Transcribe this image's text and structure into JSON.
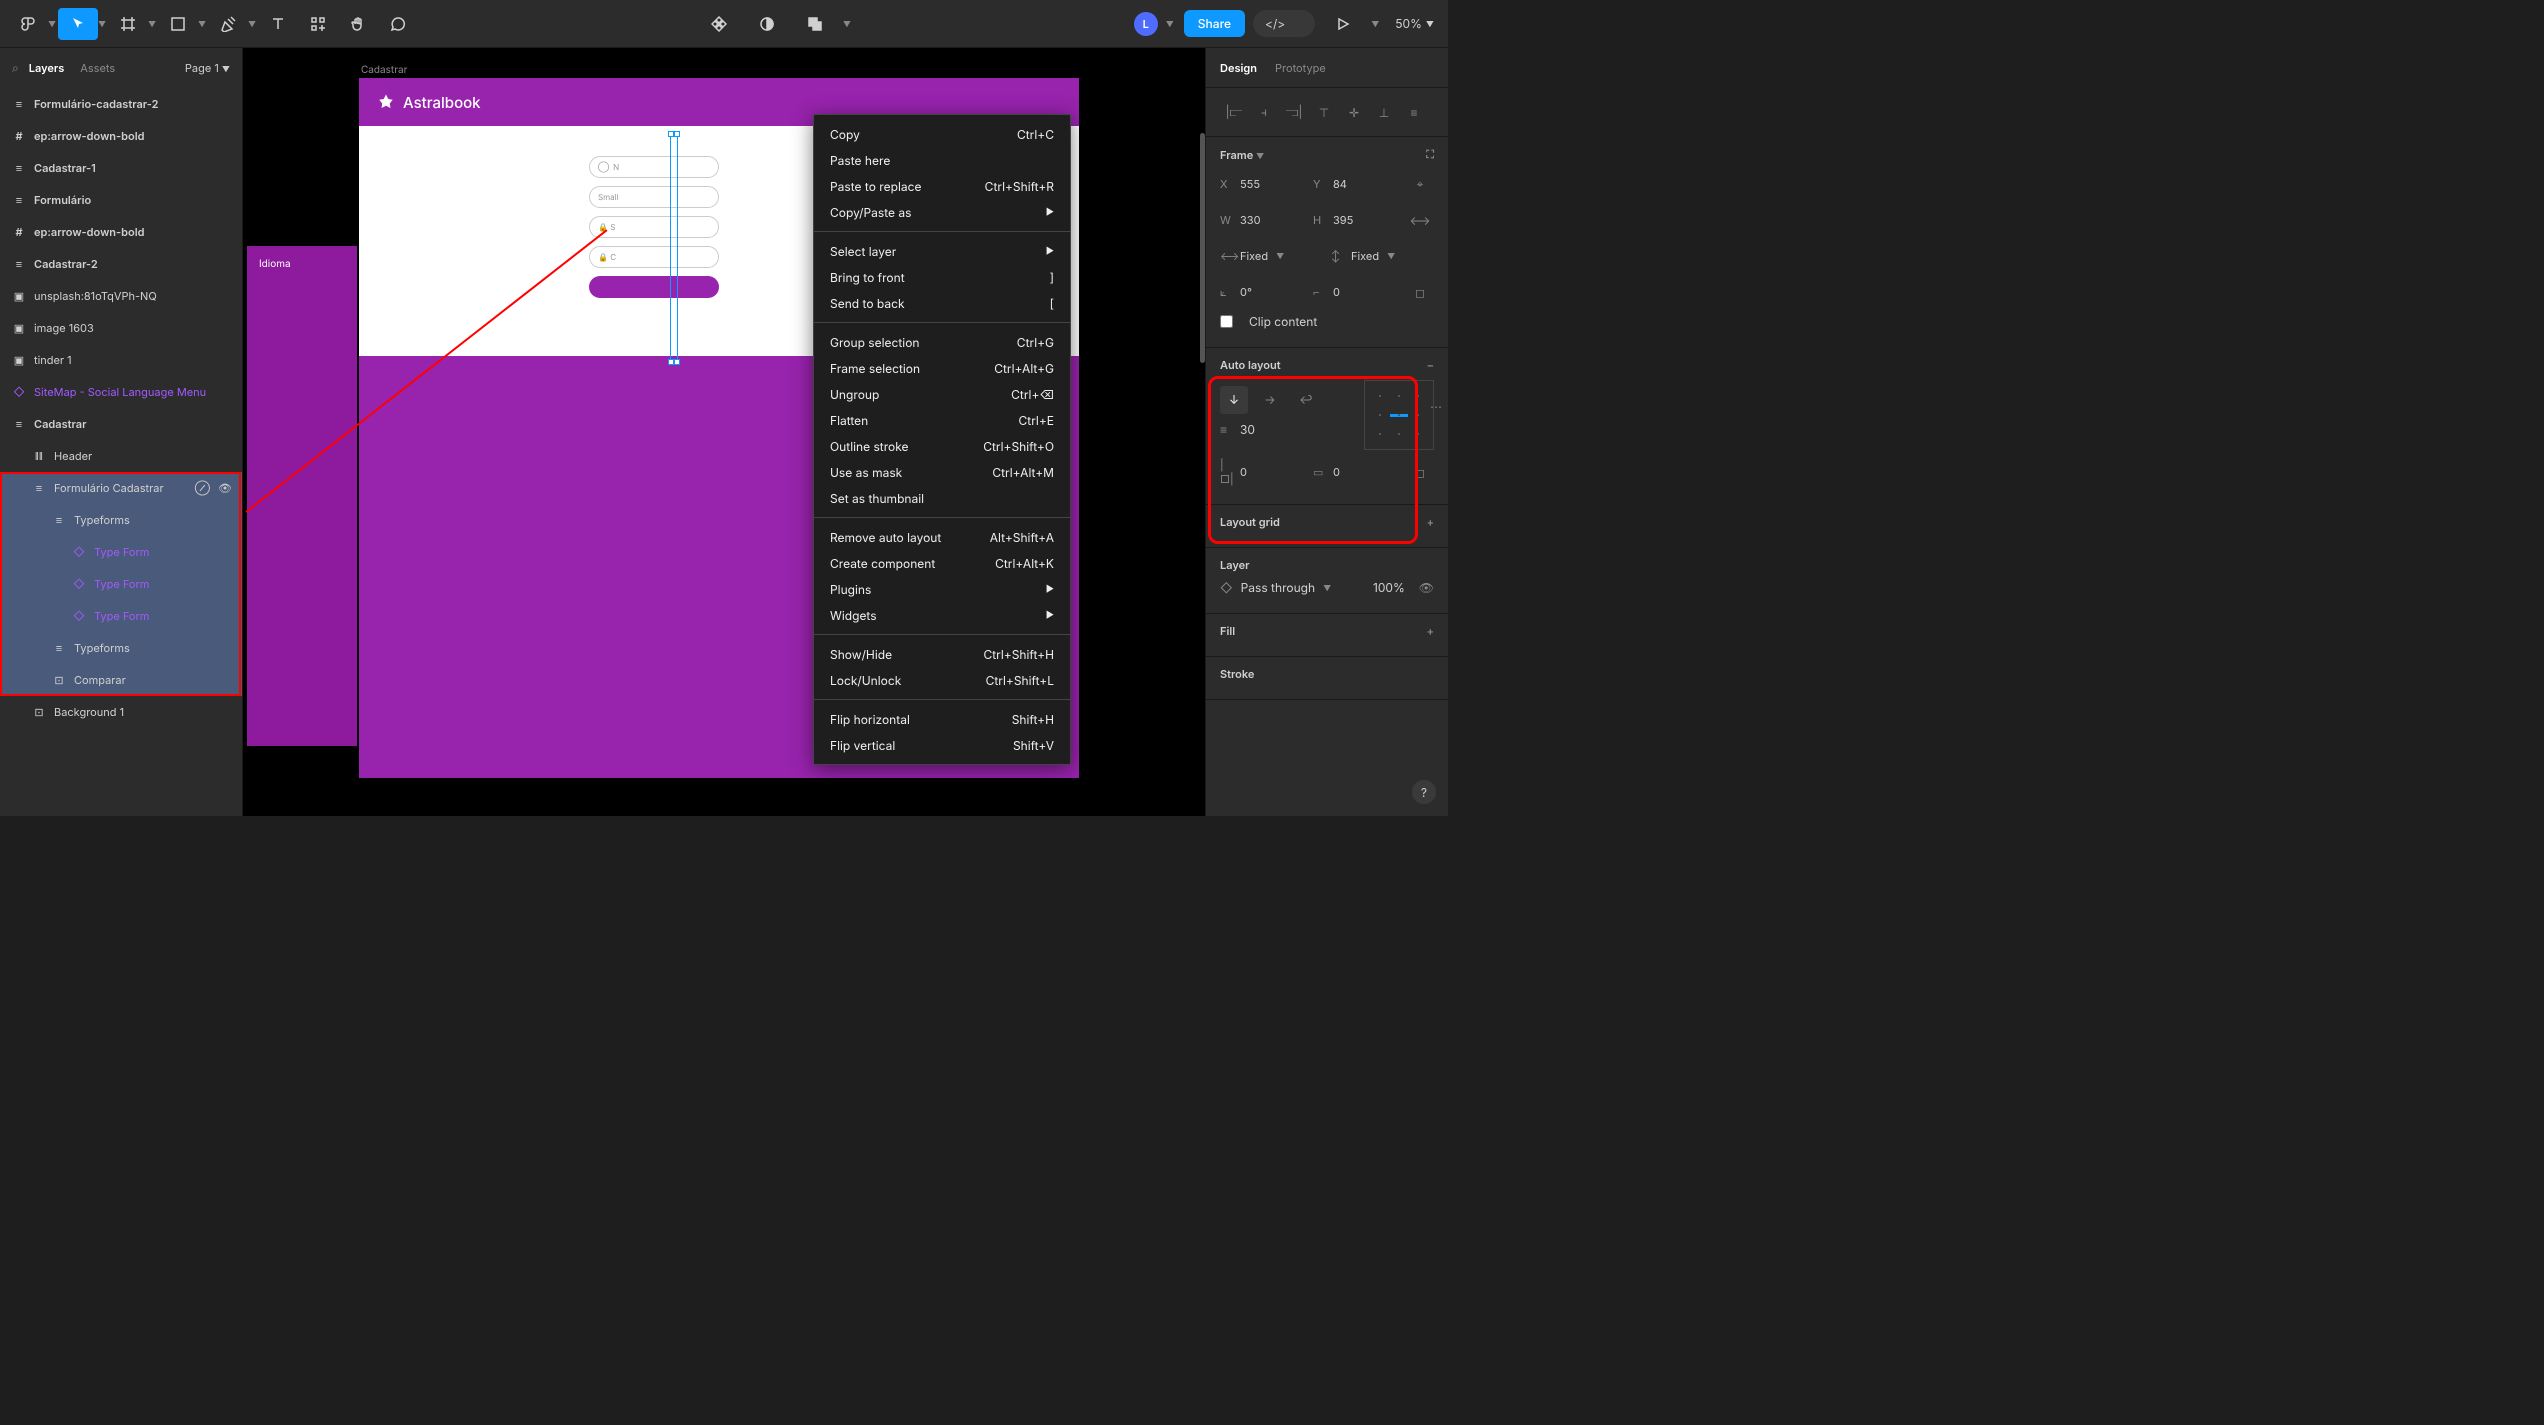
{
  "toolbar": {
    "share": "Share",
    "zoom": "50%",
    "avatar": "L"
  },
  "panel": {
    "tab_layers": "Layers",
    "tab_assets": "Assets",
    "page": "Page 1"
  },
  "layers": [
    {
      "icon": "stack",
      "label": "Formulário-cadastrar-2",
      "bold": true,
      "indent": 0
    },
    {
      "icon": "hash",
      "label": "ep:arrow-down-bold",
      "bold": true,
      "indent": 0
    },
    {
      "icon": "stack",
      "label": "Cadastrar-1",
      "bold": true,
      "indent": 0
    },
    {
      "icon": "stack",
      "label": "Formulário",
      "bold": true,
      "indent": 0
    },
    {
      "icon": "hash",
      "label": "ep:arrow-down-bold",
      "bold": true,
      "indent": 0
    },
    {
      "icon": "stack",
      "label": "Cadastrar-2",
      "bold": true,
      "indent": 0
    },
    {
      "icon": "image",
      "label": "unsplash:81oTqVPh-NQ",
      "indent": 0
    },
    {
      "icon": "image",
      "label": "image 1603",
      "indent": 0
    },
    {
      "icon": "image",
      "label": "tinder 1",
      "indent": 0
    },
    {
      "icon": "diamond",
      "label": "SiteMap - Social Language Menu",
      "purple": true,
      "indent": 0
    },
    {
      "icon": "stack",
      "label": "Cadastrar",
      "bold": true,
      "indent": 0
    },
    {
      "icon": "bars",
      "label": "Header",
      "indent": 1
    },
    {
      "icon": "stack",
      "label": "Formulário Cadastrar",
      "indent": 1,
      "selected": true,
      "actions": true
    },
    {
      "icon": "stack",
      "label": "Typeforms",
      "indent": 2,
      "selected": true
    },
    {
      "icon": "diamond",
      "label": "Type Form",
      "purple": true,
      "indent": 3,
      "selected": true
    },
    {
      "icon": "diamond",
      "label": "Type Form",
      "purple": true,
      "indent": 3,
      "selected": true
    },
    {
      "icon": "diamond",
      "label": "Type Form",
      "purple": true,
      "indent": 3,
      "selected": true
    },
    {
      "icon": "stack",
      "label": "Typeforms",
      "indent": 2,
      "selected": true
    },
    {
      "icon": "frame",
      "label": "Comparar",
      "indent": 2,
      "selected": true
    },
    {
      "icon": "frame",
      "label": "Background 1",
      "indent": 1
    }
  ],
  "canvas": {
    "frame_label": "Cadastrar",
    "logo": "Astralbook",
    "idioma": "Idioma",
    "field1": "N",
    "field2": "Small"
  },
  "context_menu": [
    {
      "label": "Copy",
      "shortcut": "Ctrl+C"
    },
    {
      "label": "Paste here"
    },
    {
      "label": "Paste to replace",
      "shortcut": "Ctrl+Shift+R"
    },
    {
      "label": "Copy/Paste as",
      "submenu": true
    },
    {
      "sep": true
    },
    {
      "label": "Select layer",
      "submenu": true
    },
    {
      "label": "Bring to front",
      "shortcut": "]"
    },
    {
      "label": "Send to back",
      "shortcut": "["
    },
    {
      "sep": true
    },
    {
      "label": "Group selection",
      "shortcut": "Ctrl+G"
    },
    {
      "label": "Frame selection",
      "shortcut": "Ctrl+Alt+G"
    },
    {
      "label": "Ungroup",
      "shortcut": "Ctrl+⌫"
    },
    {
      "label": "Flatten",
      "shortcut": "Ctrl+E"
    },
    {
      "label": "Outline stroke",
      "shortcut": "Ctrl+Shift+O"
    },
    {
      "label": "Use as mask",
      "shortcut": "Ctrl+Alt+M"
    },
    {
      "label": "Set as thumbnail"
    },
    {
      "sep": true
    },
    {
      "label": "Remove auto layout",
      "shortcut": "Alt+Shift+A"
    },
    {
      "label": "Create component",
      "shortcut": "Ctrl+Alt+K"
    },
    {
      "label": "Plugins",
      "submenu": true
    },
    {
      "label": "Widgets",
      "submenu": true
    },
    {
      "sep": true
    },
    {
      "label": "Show/Hide",
      "shortcut": "Ctrl+Shift+H"
    },
    {
      "label": "Lock/Unlock",
      "shortcut": "Ctrl+Shift+L"
    },
    {
      "sep": true
    },
    {
      "label": "Flip horizontal",
      "shortcut": "Shift+H"
    },
    {
      "label": "Flip vertical",
      "shortcut": "Shift+V"
    }
  ],
  "inspector": {
    "tab_design": "Design",
    "tab_prototype": "Prototype",
    "frame_title": "Frame",
    "x_label": "X",
    "x": "555",
    "y_label": "Y",
    "y": "84",
    "w_label": "W",
    "w": "330",
    "h_label": "H",
    "h": "395",
    "sizing_w": "Fixed",
    "sizing_h": "Fixed",
    "rotation": "0°",
    "corner": "0",
    "clip": "Clip content",
    "auto_layout": "Auto layout",
    "gap": "30",
    "pad_h": "0",
    "pad_v": "0",
    "layout_grid": "Layout grid",
    "layer": "Layer",
    "blend": "Pass through",
    "opacity": "100%",
    "fill": "Fill",
    "stroke": "Stroke"
  }
}
